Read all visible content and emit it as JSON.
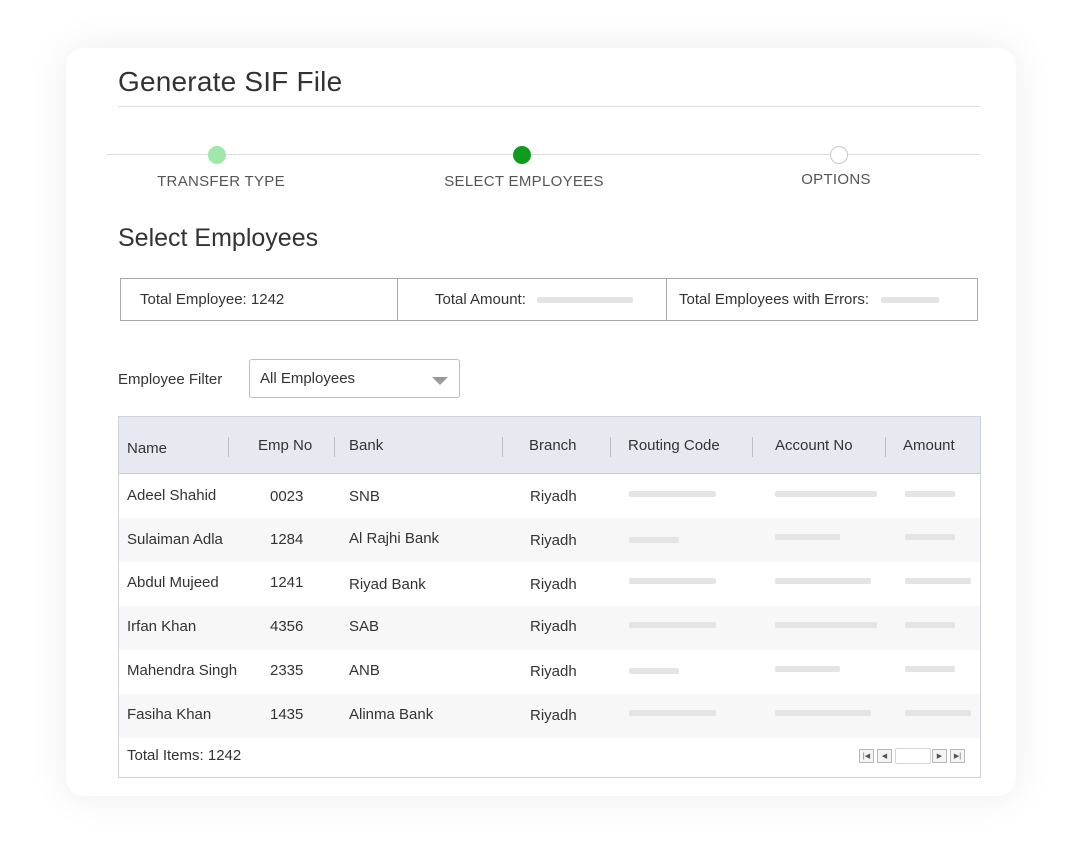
{
  "page": {
    "title": "Generate SIF File"
  },
  "stepper": {
    "steps": [
      {
        "label": "TRANSFER TYPE",
        "state": "done",
        "color": "#9fe8a9"
      },
      {
        "label": "SELECT EMPLOYEES",
        "state": "active",
        "color": "#0e9c1f"
      },
      {
        "label": "OPTIONS",
        "state": "pending",
        "color": "#ffffff"
      }
    ]
  },
  "section": {
    "title": "Select Employees"
  },
  "summary": {
    "total_employee": "Total Employee: 1242",
    "total_amount_label": "Total Amount:",
    "errors_label": "Total Employees with Errors:"
  },
  "filter": {
    "label": "Employee Filter",
    "selected": "All Employees"
  },
  "table": {
    "columns": [
      "Name",
      "Emp No",
      "Bank",
      "Branch",
      "Routing Code",
      "Account No",
      "Amount"
    ],
    "rows": [
      {
        "name": "Adeel Shahid",
        "emp_no": "0023",
        "bank": "SNB",
        "branch": "Riyadh"
      },
      {
        "name": "Sulaiman Adla",
        "emp_no": "1284",
        "bank": "Al Rajhi Bank",
        "branch": "Riyadh"
      },
      {
        "name": "Abdul Mujeed",
        "emp_no": "1241",
        "bank": "Riyad Bank",
        "branch": "Riyadh"
      },
      {
        "name": "Irfan Khan",
        "emp_no": "4356",
        "bank": "SAB",
        "branch": "Riyadh"
      },
      {
        "name": "Mahendra Singh",
        "emp_no": "2335",
        "bank": "ANB",
        "branch": "Riyadh"
      },
      {
        "name": "Fasiha Khan",
        "emp_no": "1435",
        "bank": "Alinma Bank",
        "branch": "Riyadh"
      }
    ],
    "footer": "Total Items: 1242"
  },
  "pager": {
    "icons": [
      "first-page-icon",
      "prev-page-icon",
      "next-page-icon",
      "last-page-icon"
    ]
  },
  "colors": {
    "header_bg": "#e6eaf0",
    "placeholder": "#e4e4e4",
    "accent": "#0e9c1f"
  }
}
